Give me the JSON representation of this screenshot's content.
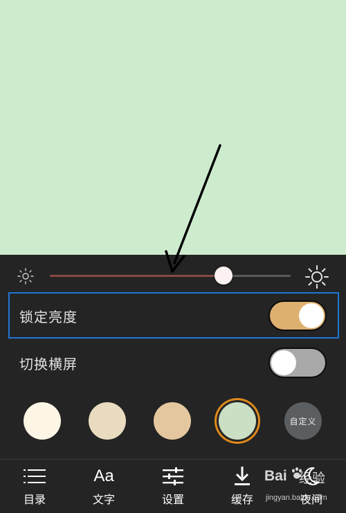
{
  "settings": {
    "lock_brightness_label": "锁定亮度",
    "lock_brightness_on": true,
    "landscape_label": "切换横屏",
    "landscape_on": false
  },
  "brightness": {
    "level": 0.72
  },
  "themes": {
    "swatches": [
      "#fdf6e6",
      "#e9dbbf",
      "#e5c79f",
      "#cbdfc4"
    ],
    "selected_index": 3,
    "custom_label": "自定义"
  },
  "nav": {
    "items": [
      {
        "label": "目录",
        "icon": "list-icon"
      },
      {
        "label": "文字",
        "icon": "font-icon",
        "glyph": "Aa"
      },
      {
        "label": "设置",
        "icon": "sliders-icon"
      },
      {
        "label": "缓存",
        "icon": "download-icon"
      },
      {
        "label": "夜间",
        "icon": "moon-icon"
      }
    ]
  },
  "watermark": {
    "brand": "Bai",
    "brand_suffix": "经验",
    "url": "jingyan.baidu.com"
  },
  "colors": {
    "reading_background": "#cdecce",
    "panel_background": "#242424",
    "toggle_on": "#deb070",
    "toggle_off": "#a9a9a9",
    "slider_fill": "#8a4a44",
    "highlight_border": "#1f77d6",
    "selected_ring": "#e08a1c"
  }
}
